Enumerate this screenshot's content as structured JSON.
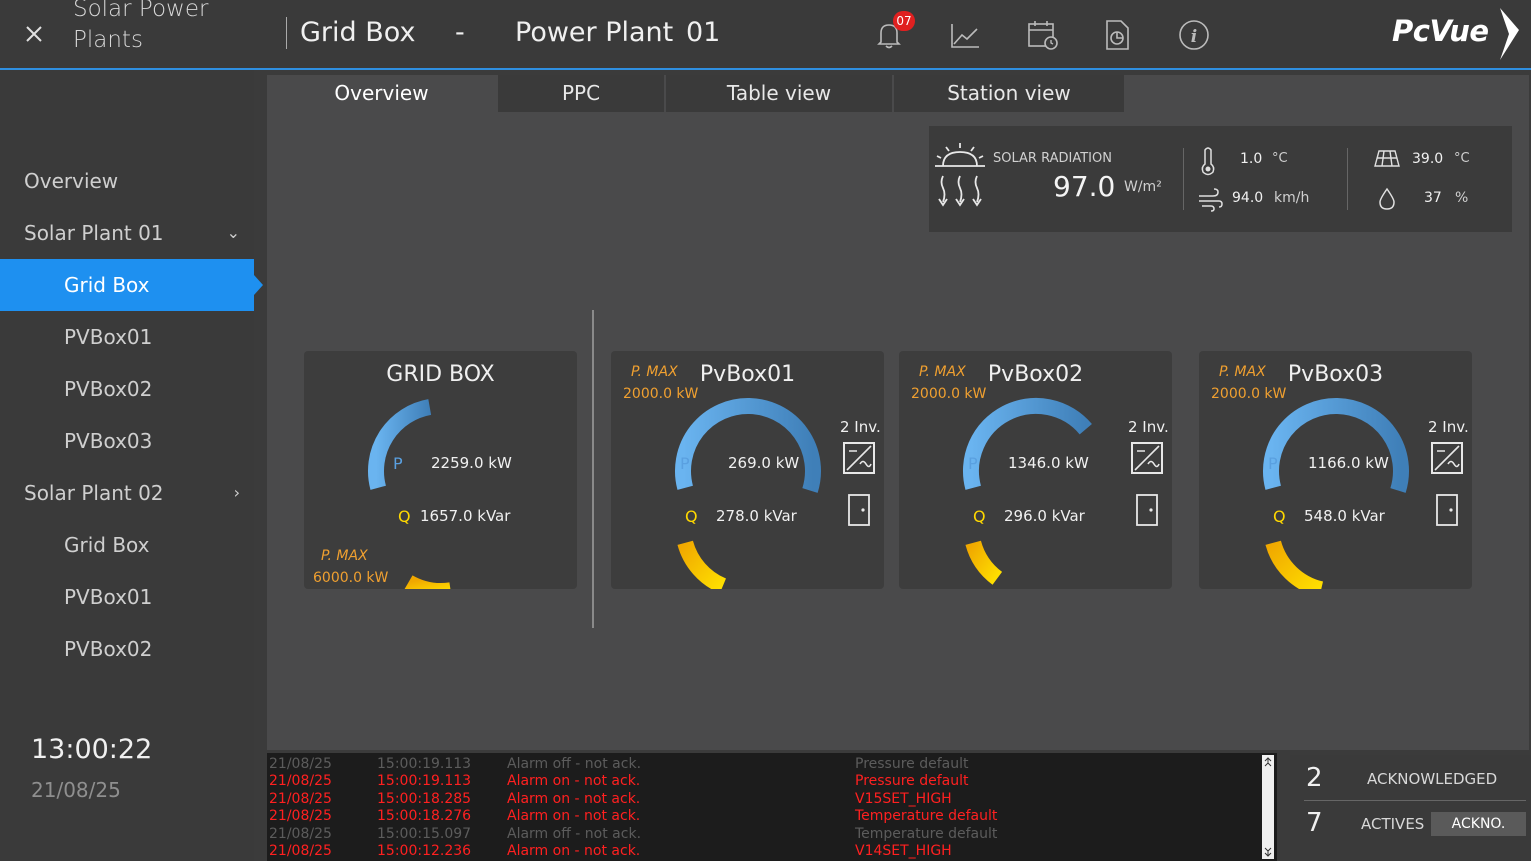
{
  "app": {
    "title_line1": "Solar Power",
    "title_line2": "Plants",
    "context_title": "Grid Box",
    "context_dash": "-",
    "plant_name": "Power Plant",
    "plant_number": "01",
    "notification_count": "07",
    "logo": "PcVue"
  },
  "sidebar": {
    "items": [
      {
        "label": "Overview"
      },
      {
        "label": "Solar Plant 01"
      },
      {
        "label": "Grid Box"
      },
      {
        "label": "PVBox01"
      },
      {
        "label": "PVBox02"
      },
      {
        "label": "PVBox03"
      },
      {
        "label": "Solar Plant 02"
      },
      {
        "label": "Grid Box"
      },
      {
        "label": "PVBox01"
      },
      {
        "label": "PVBox02"
      }
    ],
    "time": "13:00:22",
    "date": "21/08/25"
  },
  "tabs": [
    "Overview",
    "PPC",
    "Table view",
    "Station view"
  ],
  "weather": {
    "radiation_label": "SOLAR RADIATION",
    "radiation_value": "97.0",
    "radiation_unit": "W/m²",
    "temp_value": "1.0",
    "temp_unit": "°C",
    "wind_value": "94.0",
    "wind_unit": "km/h",
    "panel_temp_value": "39.0",
    "panel_temp_unit": "°C",
    "humidity_value": "37",
    "humidity_unit": "%"
  },
  "cards": [
    {
      "title": "GRID BOX",
      "pmax_label": "P. MAX",
      "pmax_value": "6000.0 kW",
      "p_label": "P",
      "p_value": "2259.0 kW",
      "q_label": "Q",
      "q_value": "1657.0 kVar",
      "p_fraction": 0.38,
      "q_fraction": 0.28
    },
    {
      "title": "PvBox01",
      "pmax_label": "P. MAX",
      "pmax_value": "2000.0 kW",
      "p_label": "P",
      "p_value": "269.0 kW",
      "q_label": "Q",
      "q_value": "278.0 kVar",
      "inv": "2 Inv.",
      "p_fraction": 0.85,
      "q_fraction": 0.38
    },
    {
      "title": "PvBox02",
      "pmax_label": "P. MAX",
      "pmax_value": "2000.0 kW",
      "p_label": "P",
      "p_value": "1346.0 kW",
      "q_label": "Q",
      "q_value": "296.0 kVar",
      "inv": "2 Inv.",
      "p_fraction": 0.62,
      "q_fraction": 0.28
    },
    {
      "title": "PvBox03",
      "pmax_label": "P. MAX",
      "pmax_value": "2000.0 kW",
      "p_label": "P",
      "p_value": "1166.0 kW",
      "q_label": "Q",
      "q_value": "548.0 kVar",
      "inv": "2 Inv.",
      "p_fraction": 0.85,
      "q_fraction": 0.45
    }
  ],
  "alarms": [
    {
      "state": "off",
      "date": "21/08/25",
      "time": "15:00:19.113",
      "status": "Alarm off - not ack.",
      "desc": "Pressure default"
    },
    {
      "state": "on",
      "date": "21/08/25",
      "time": "15:00:19.113",
      "status": "Alarm on - not ack.",
      "desc": "Pressure default"
    },
    {
      "state": "on",
      "date": "21/08/25",
      "time": "15:00:18.285",
      "status": "Alarm on - not ack.",
      "desc": "V15SET_HIGH"
    },
    {
      "state": "on",
      "date": "21/08/25",
      "time": "15:00:18.276",
      "status": "Alarm on - not ack.",
      "desc": "Temperature default"
    },
    {
      "state": "off",
      "date": "21/08/25",
      "time": "15:00:15.097",
      "status": "Alarm off - not ack.",
      "desc": "Temperature default"
    },
    {
      "state": "on",
      "date": "21/08/25",
      "time": "15:00:12.236",
      "status": "Alarm on - not ack.",
      "desc": "V14SET_HIGH"
    }
  ],
  "summary": {
    "acknowledged_count": "2",
    "acknowledged_label": "ACKNOWLEDGED",
    "actives_count": "7",
    "actives_label": "ACTIVES",
    "ack_button": "ACKNO."
  },
  "colors": {
    "accent": "#1e90f0",
    "alarm_on": "#ff2020",
    "pmax": "#f0a030",
    "gauge_p": "#5aa0e0",
    "gauge_q": "#ffd800"
  }
}
